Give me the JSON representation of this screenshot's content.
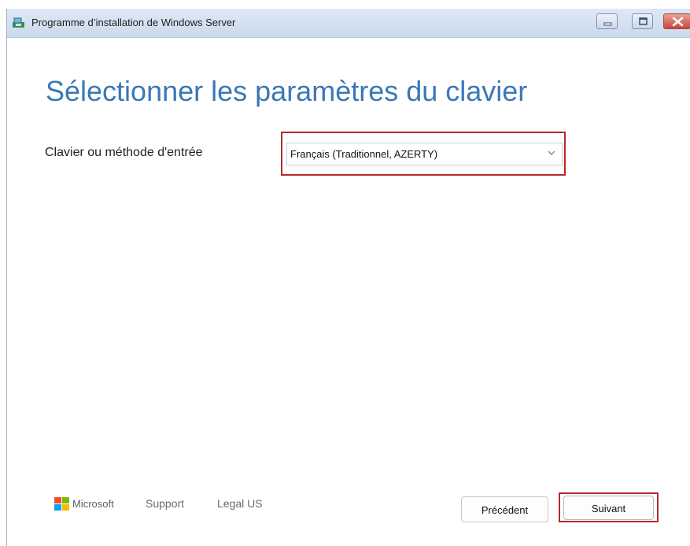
{
  "window": {
    "title": "Programme d’installation de Windows Server",
    "controls": {
      "minimize_icon": "minimize-icon",
      "maximize_icon": "maximize-icon",
      "close_icon": "close-icon"
    }
  },
  "page": {
    "heading": "Sélectionner les paramètres du clavier"
  },
  "keyboard": {
    "label": "Clavier ou méthode d'entrée",
    "selected": "Français (Traditionnel, AZERTY)"
  },
  "footer": {
    "brand": "Microsoft",
    "support": "Support",
    "legal": "Legal US",
    "previous": "Précédent",
    "next": "Suivant"
  },
  "colors": {
    "heading": "#3a78b6",
    "highlight": "#b52a2a"
  }
}
